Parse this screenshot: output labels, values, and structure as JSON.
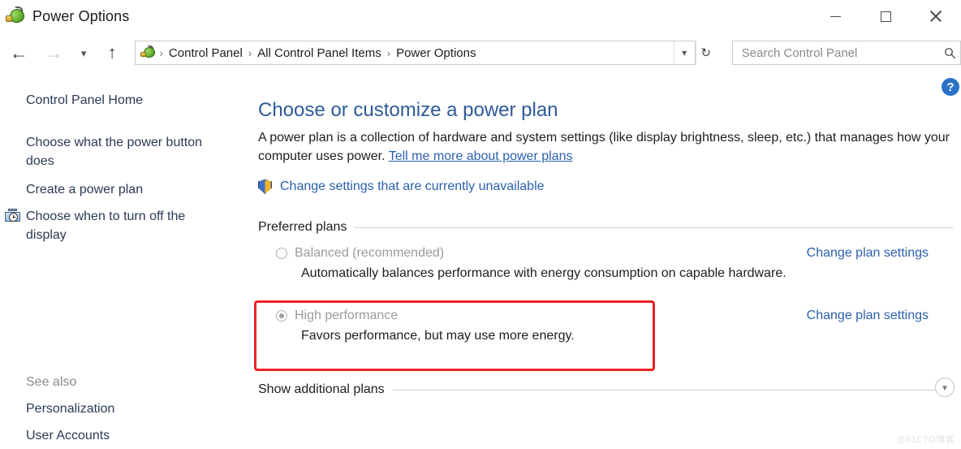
{
  "window": {
    "title": "Power Options",
    "app_icon": "power-plug-icon",
    "controls": {
      "minimize": "minimize-button",
      "maximize": "maximize-button",
      "close": "close-button"
    }
  },
  "navbar": {
    "back": "back-arrow-icon",
    "forward": "forward-arrow-icon",
    "recent": "recent-locations-chevron-icon",
    "up": "up-arrow-icon",
    "breadcrumbs": [
      "Control Panel",
      "All Control Panel Items",
      "Power Options"
    ],
    "separator": "›",
    "dropdown": "chevron-down-icon",
    "refresh": "refresh-icon",
    "search": {
      "placeholder": "Search Control Panel",
      "value": "",
      "icon": "search-icon"
    }
  },
  "help": {
    "label": "?"
  },
  "sidebar": {
    "items": [
      {
        "label": "Control Panel Home",
        "icon": null
      },
      {
        "label": "Choose what the power button does",
        "icon": null
      },
      {
        "label": "Create a power plan",
        "icon": "shield-icon"
      },
      {
        "label": "Choose when to turn off the display",
        "icon": "monitor-clock-icon"
      }
    ],
    "see_also_heading": "See also",
    "see_also": [
      {
        "label": "Personalization"
      },
      {
        "label": "User Accounts"
      }
    ]
  },
  "main": {
    "page_title": "Choose or customize a power plan",
    "intro_text_1": "A power plan is a collection of hardware and system settings (like display brightness, sleep, etc.) that manages how your computer uses power. ",
    "intro_link": "Tell me more about power plans",
    "uac_link": "Change settings that are currently unavailable",
    "uac_icon": "shield-icon",
    "preferred_plans_heading": "Preferred plans",
    "additional_plans_heading": "Show additional plans",
    "expander_icon": "chevron-down-circle-icon",
    "plans": [
      {
        "name": "Balanced (recommended)",
        "description": "Automatically balances performance with energy consumption on capable hardware.",
        "selected": false,
        "change_link": "Change plan settings"
      },
      {
        "name": "High performance",
        "description": "Favors performance, but may use more energy.",
        "selected": true,
        "change_link": "Change plan settings"
      }
    ]
  },
  "annotation": {
    "highlight_color": "#ec2222",
    "target": "High performance"
  },
  "watermark": "@51CTO博客"
}
